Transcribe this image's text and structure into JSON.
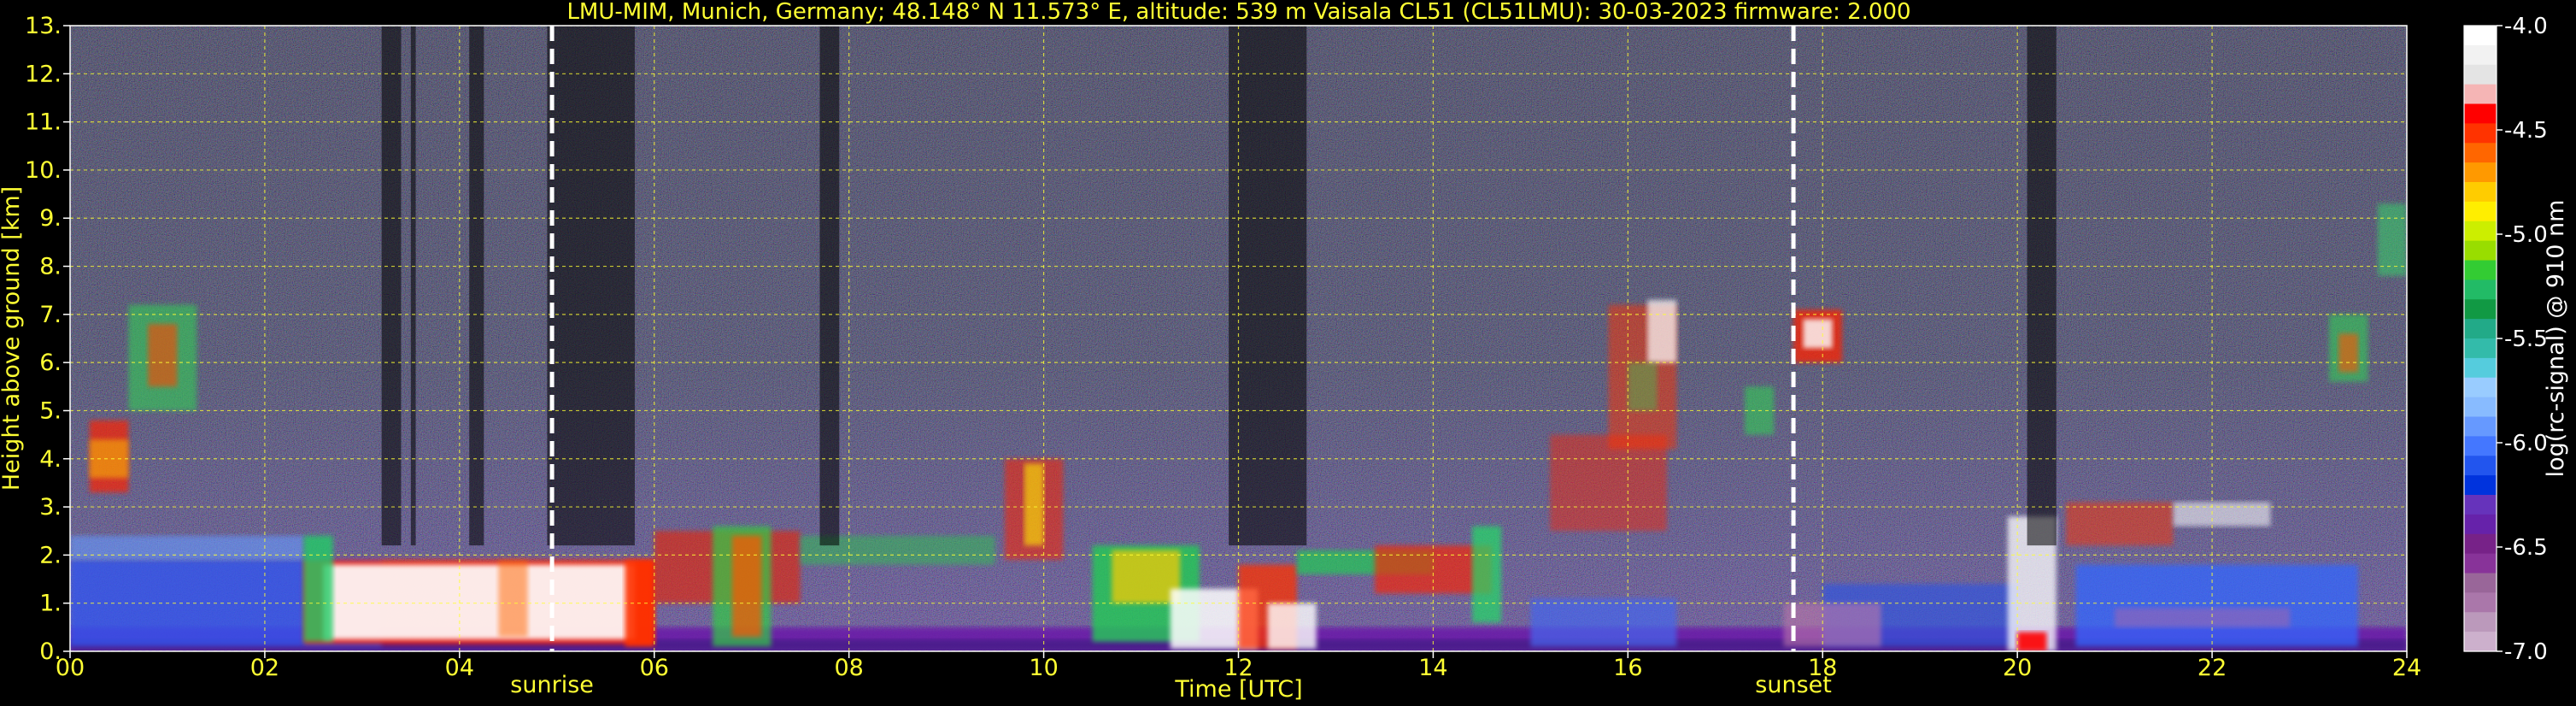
{
  "chart_data": {
    "type": "heatmap",
    "title": "LMU-MIM, Munich, Germany; 48.148° N 11.573° E, altitude: 539 m    Vaisala CL51 (CL51LMU): 30-03-2023    firmware: 2.000",
    "xlabel": "Time [UTC]",
    "ylabel": "Height above ground [km]",
    "colorbar_label": "log(rc-signal) @ 910 nm",
    "xlim": [
      0,
      24
    ],
    "ylim": [
      0,
      13
    ],
    "xticks": [
      0,
      2,
      4,
      6,
      8,
      10,
      12,
      14,
      16,
      18,
      20,
      22,
      24
    ],
    "xtick_labels": [
      "00",
      "02",
      "04",
      "06",
      "08",
      "10",
      "12",
      "14",
      "16",
      "18",
      "20",
      "22",
      "24"
    ],
    "yticks": [
      0,
      1,
      2,
      3,
      4,
      5,
      6,
      7,
      8,
      9,
      10,
      11,
      12,
      13
    ],
    "ytick_labels": [
      "0.",
      "1.",
      "2.",
      "3.",
      "4.",
      "5.",
      "6.",
      "7.",
      "8.",
      "9.",
      "10.",
      "11.",
      "12.",
      "13."
    ],
    "colorbar_range": [
      -7.0,
      -4.0
    ],
    "colorbar_ticks": [
      -4.0,
      -4.5,
      -5.0,
      -5.5,
      -6.0,
      -6.5,
      -7.0
    ],
    "colorbar_tick_labels": [
      "-4.0",
      "-4.5",
      "-5.0",
      "-5.5",
      "-6.0",
      "-6.5",
      "-7.0"
    ],
    "colorbar_colors": [
      "#ffffff",
      "#f2f2f2",
      "#e4e4e4",
      "#f5b5b5",
      "#ff0000",
      "#ff3300",
      "#ff6600",
      "#ff9900",
      "#ffcc00",
      "#ffee00",
      "#ccee00",
      "#99dd00",
      "#33cc33",
      "#22bb66",
      "#119944",
      "#22aa88",
      "#33bbaa",
      "#55ccdd",
      "#99ccff",
      "#88bbff",
      "#6699ff",
      "#4477ff",
      "#2255ee",
      "#0033dd",
      "#6633bb",
      "#6622aa",
      "#772288",
      "#883399",
      "#996699",
      "#aa77aa",
      "#bb99bb",
      "#ccb0cc"
    ],
    "grid": true,
    "markers": [
      {
        "label": "sunrise",
        "x": 4.95
      },
      {
        "label": "sunset",
        "x": 17.7
      }
    ]
  }
}
